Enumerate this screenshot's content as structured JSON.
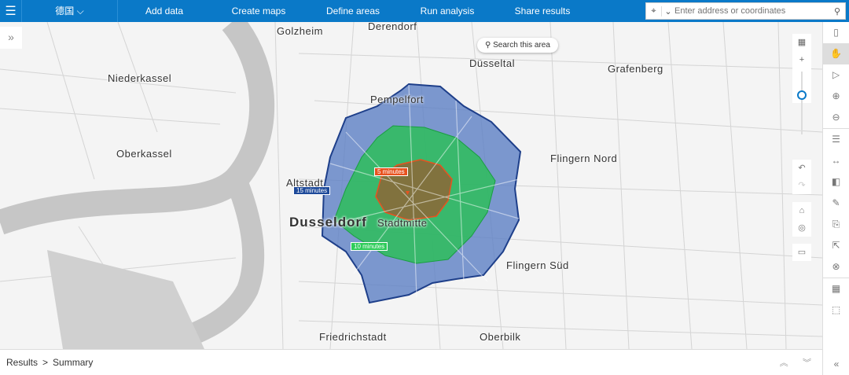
{
  "topbar": {
    "region": "德国",
    "nav": [
      "Add data",
      "Create maps",
      "Define areas",
      "Run analysis",
      "Share results"
    ],
    "search_placeholder": "Enter address or coordinates"
  },
  "map": {
    "search_area": "Search this area",
    "places": {
      "golzheim": "Golzheim",
      "derendorf": "Derendorf",
      "dusseltal": "Düsseltal",
      "niederkassel": "Niederkassel",
      "grafenberg": "Grafenberg",
      "pempelfort": "Pempelfort",
      "oberkassel": "Oberkassel",
      "flingern_nord": "Flingern Nord",
      "altstadt": "Altstadt",
      "dusseldorf": "Dusseldorf",
      "stadtmitte": "Stadtmitte",
      "flingern_sud": "Flingern Süd",
      "friedrichstadt": "Friedrichstadt",
      "oberbilk": "Oberbilk"
    },
    "isochrones": [
      {
        "label": "5 minutes",
        "color": "#e8521f"
      },
      {
        "label": "10 minutes",
        "color": "#2ecc5a"
      },
      {
        "label": "15 minutes",
        "color": "#1e4a9a"
      }
    ],
    "zoom_level_fraction": 0.6
  },
  "bottom": {
    "results": "Results",
    "sep": ">",
    "summary": "Summary"
  }
}
